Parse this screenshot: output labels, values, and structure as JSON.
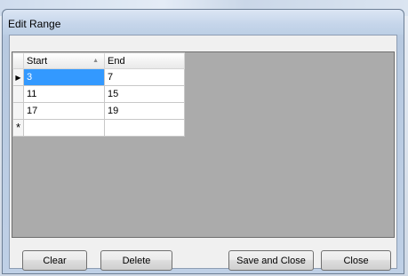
{
  "window": {
    "title": "Edit Range"
  },
  "grid": {
    "columns": [
      "Start",
      "End"
    ],
    "sort_indicator": "ascending",
    "rows": [
      {
        "marker": "current-row-arrow",
        "start": "3",
        "end": "7"
      },
      {
        "marker": "",
        "start": "11",
        "end": "15"
      },
      {
        "marker": "",
        "start": "17",
        "end": "19"
      }
    ],
    "new_row_marker": "*",
    "selected_cell": {
      "row": 0,
      "column": "Start"
    },
    "selection_color": "#3399ff"
  },
  "buttons": {
    "clear": "Clear",
    "delete": "Delete",
    "save_and_close": "Save and Close",
    "close": "Close"
  }
}
